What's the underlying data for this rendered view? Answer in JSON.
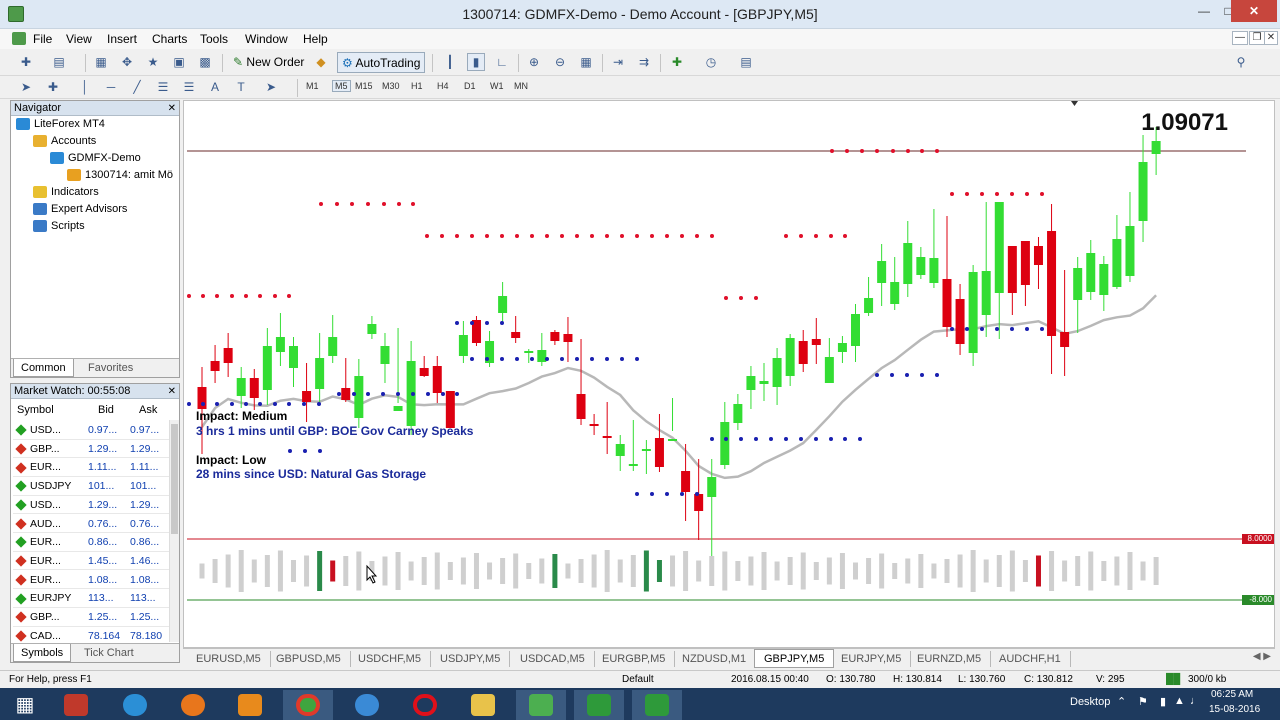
{
  "window": {
    "title": "1300714: GDMFX-Demo - Demo Account - [GBPJPY,M5]"
  },
  "menu": [
    "File",
    "View",
    "Insert",
    "Charts",
    "Tools",
    "Window",
    "Help"
  ],
  "toolbar": {
    "new_order": "New Order",
    "autotrading": "AutoTrading"
  },
  "timeframes": [
    "M1",
    "M5",
    "M15",
    "M30",
    "H1",
    "H4",
    "D1",
    "W1",
    "MN"
  ],
  "navigator": {
    "title": "Navigator",
    "tree": [
      {
        "label": "LiteForex MT4",
        "level": 0,
        "icon": "terminal-icon"
      },
      {
        "label": "Accounts",
        "level": 1,
        "icon": "accounts-icon"
      },
      {
        "label": "GDMFX-Demo",
        "level": 2,
        "icon": "server-icon"
      },
      {
        "label": "1300714: amit Mö",
        "level": 3,
        "icon": "user-icon"
      },
      {
        "label": "Indicators",
        "level": 1,
        "icon": "indicators-icon"
      },
      {
        "label": "Expert Advisors",
        "level": 1,
        "icon": "experts-icon"
      },
      {
        "label": "Scripts",
        "level": 1,
        "icon": "scripts-icon"
      }
    ],
    "tabs": [
      "Common",
      "Favorites"
    ]
  },
  "market_watch": {
    "title": "Market Watch: 00:55:08",
    "columns": [
      "Symbol",
      "Bid",
      "Ask"
    ],
    "rows": [
      {
        "symbol": "USD...",
        "bid": "0.97...",
        "ask": "0.97...",
        "dir": "up"
      },
      {
        "symbol": "GBP...",
        "bid": "1.29...",
        "ask": "1.29...",
        "dir": "down"
      },
      {
        "symbol": "EUR...",
        "bid": "1.11...",
        "ask": "1.11...",
        "dir": "down"
      },
      {
        "symbol": "USDJPY",
        "bid": "101...",
        "ask": "101...",
        "dir": "up"
      },
      {
        "symbol": "USD...",
        "bid": "1.29...",
        "ask": "1.29...",
        "dir": "up"
      },
      {
        "symbol": "AUD...",
        "bid": "0.76...",
        "ask": "0.76...",
        "dir": "down"
      },
      {
        "symbol": "EUR...",
        "bid": "0.86...",
        "ask": "0.86...",
        "dir": "up"
      },
      {
        "symbol": "EUR...",
        "bid": "1.45...",
        "ask": "1.46...",
        "dir": "down"
      },
      {
        "symbol": "EUR...",
        "bid": "1.08...",
        "ask": "1.08...",
        "dir": "down"
      },
      {
        "symbol": "EURJPY",
        "bid": "113...",
        "ask": "113...",
        "dir": "up"
      },
      {
        "symbol": "GBP...",
        "bid": "1.25...",
        "ask": "1.25...",
        "dir": "down"
      },
      {
        "symbol": "CAD...",
        "bid": "78.164",
        "ask": "78.180",
        "dir": "down"
      }
    ],
    "tabs": [
      "Symbols",
      "Tick Chart"
    ]
  },
  "chart": {
    "price": "1.09071",
    "news": [
      {
        "impact": "Impact: Medium",
        "text": "3 hrs 1 mins until GBP: BOE Gov Carney Speaks",
        "color": "#e020e0"
      },
      {
        "impact": "Impact: Low",
        "text": "28 mins since USD: Natural Gas Storage",
        "color": "#e8922c"
      }
    ],
    "osc_levels": [
      "8.0000",
      "-8.000"
    ],
    "candles": [
      [
        286,
        308,
        266,
        353,
        0
      ],
      [
        260,
        270,
        244,
        282,
        0
      ],
      [
        247,
        262,
        232,
        276,
        0
      ],
      [
        277,
        295,
        266,
        307,
        1
      ],
      [
        277,
        297,
        268,
        309,
        0
      ],
      [
        245,
        289,
        227,
        304,
        1
      ],
      [
        236,
        251,
        212,
        265,
        1
      ],
      [
        245,
        267,
        236,
        286,
        1
      ],
      [
        290,
        301,
        262,
        321,
        0
      ],
      [
        257,
        288,
        232,
        301,
        1
      ],
      [
        236,
        255,
        214,
        262,
        1
      ],
      [
        287,
        299,
        257,
        301,
        0
      ],
      [
        275,
        317,
        258,
        327,
        1
      ],
      [
        223,
        233,
        215,
        238,
        1
      ],
      [
        245,
        263,
        232,
        282,
        1
      ],
      [
        310,
        305,
        227,
        302,
        1
      ],
      [
        260,
        325,
        240,
        334,
        1
      ],
      [
        267,
        275,
        255,
        276,
        0
      ],
      [
        265,
        292,
        255,
        302,
        0
      ],
      [
        327,
        290,
        297,
        300,
        0
      ],
      [
        234,
        255,
        220,
        262,
        1
      ],
      [
        219,
        242,
        215,
        245,
        0
      ],
      [
        240,
        262,
        230,
        266,
        1
      ],
      [
        195,
        212,
        181,
        221,
        1
      ],
      [
        231,
        237,
        215,
        242,
        0
      ],
      [
        252,
        250,
        248,
        262,
        1
      ],
      [
        249,
        261,
        232,
        265,
        1
      ],
      [
        231,
        240,
        229,
        244,
        0
      ],
      [
        233,
        241,
        216,
        261,
        0
      ],
      [
        293,
        318,
        238,
        324,
        0
      ],
      [
        325,
        323,
        313,
        334,
        0
      ],
      [
        337,
        335,
        301,
        353,
        0
      ],
      [
        355,
        343,
        334,
        370,
        1
      ],
      [
        363,
        365,
        319,
        370,
        1
      ],
      [
        348,
        348,
        339,
        373,
        1
      ],
      [
        366,
        337,
        313,
        371,
        0
      ],
      [
        338,
        338,
        297,
        330,
        1
      ],
      [
        391,
        370,
        343,
        420,
        0
      ],
      [
        410,
        393,
        358,
        439,
        0
      ],
      [
        376,
        396,
        358,
        456,
        1
      ],
      [
        321,
        364,
        301,
        368,
        1
      ],
      [
        303,
        322,
        293,
        329,
        1
      ],
      [
        275,
        289,
        265,
        308,
        1
      ],
      [
        280,
        283,
        262,
        300,
        1
      ],
      [
        257,
        286,
        247,
        304,
        1
      ],
      [
        237,
        275,
        233,
        285,
        1
      ],
      [
        240,
        263,
        229,
        271,
        0
      ],
      [
        244,
        238,
        217,
        263,
        0
      ],
      [
        282,
        256,
        237,
        270,
        1
      ],
      [
        242,
        251,
        235,
        262,
        1
      ],
      [
        213,
        245,
        203,
        261,
        1
      ],
      [
        197,
        212,
        176,
        215,
        1
      ],
      [
        160,
        182,
        143,
        205,
        1
      ],
      [
        181,
        203,
        156,
        209,
        1
      ],
      [
        142,
        183,
        120,
        196,
        1
      ],
      [
        156,
        174,
        146,
        178,
        1
      ],
      [
        157,
        182,
        108,
        187,
        1
      ],
      [
        178,
        226,
        115,
        236,
        0
      ],
      [
        198,
        243,
        183,
        254,
        0
      ],
      [
        171,
        252,
        164,
        265,
        1
      ],
      [
        170,
        214,
        101,
        236,
        1
      ],
      [
        101,
        192,
        133,
        238,
        1
      ],
      [
        145,
        192,
        174,
        214,
        0
      ],
      [
        140,
        184,
        163,
        205,
        0
      ],
      [
        145,
        164,
        136,
        188,
        0
      ],
      [
        130,
        235,
        103,
        273,
        0
      ],
      [
        231,
        246,
        169,
        275,
        0
      ],
      [
        167,
        199,
        156,
        232,
        1
      ],
      [
        152,
        191,
        139,
        199,
        1
      ],
      [
        163,
        194,
        155,
        210,
        1
      ],
      [
        138,
        186,
        114,
        188,
        1
      ],
      [
        125,
        175,
        91,
        181,
        1
      ],
      [
        61,
        120,
        34,
        141,
        1
      ],
      [
        40,
        53,
        26,
        74,
        1
      ]
    ]
  },
  "chart_tabs": [
    "EURUSD,M5",
    "GBPUSD,M5",
    "USDCHF,M5",
    "USDJPY,M5",
    "USDCAD,M5",
    "EURGBP,M5",
    "NZDUSD,M1",
    "GBPJPY,M5",
    "EURJPY,M5",
    "EURNZD,M5",
    "AUDCHF,H1"
  ],
  "active_chart_tab": 7,
  "status": {
    "help": "For Help, press F1",
    "profile": "Default",
    "datetime": "2016.08.15 00:40",
    "open": "O: 130.780",
    "high": "H: 130.814",
    "low": "L: 130.760",
    "close": "C: 130.812",
    "volume": "V: 295",
    "traffic": "300/0 kb"
  },
  "taskbar": {
    "desktop_label": "Desktop",
    "time": "06:25 AM",
    "date": "15-08-2016"
  },
  "colors": {
    "bull": "#33dd33",
    "bear": "#dd0010",
    "resistance_dots": "#e0102a",
    "support_dots": "#1a20b0",
    "ma": "#b8b8b8"
  }
}
